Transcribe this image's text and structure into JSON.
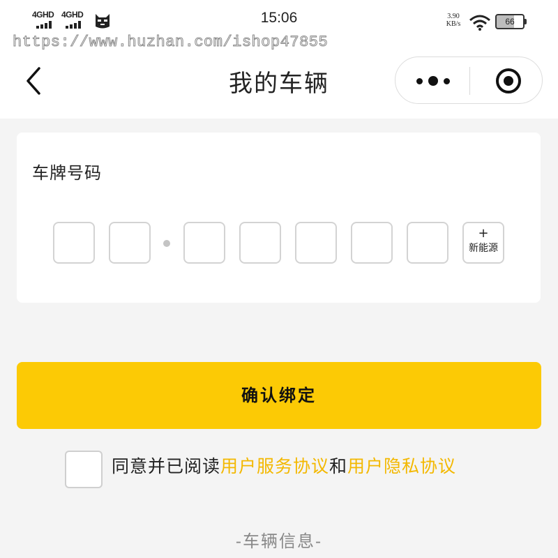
{
  "status_bar": {
    "signal1": "4GHD",
    "signal2": "4GHD",
    "time": "15:06",
    "speed_value": "3.90",
    "speed_unit": "KB/s",
    "battery": "66",
    "battery_level": 0.66
  },
  "watermark": "https://www.huzhan.com/ishop47855",
  "nav": {
    "back_icon": "chevron-left-icon",
    "title": "我的车辆",
    "more_icon": "more-dots-icon",
    "close_icon": "target-close-icon"
  },
  "plate": {
    "label": "车牌号码",
    "boxes": [
      "",
      "",
      "",
      "",
      "",
      "",
      ""
    ],
    "new_energy_plus": "+",
    "new_energy_label": "新能源"
  },
  "confirm_label": "确认绑定",
  "agreement": {
    "prefix": "同意并已阅读",
    "link1": "用户服务协议",
    "conj": "和",
    "link2": "用户隐私协议"
  },
  "section_title": "-车辆信息-",
  "colors": {
    "accent": "#fcca05",
    "link": "#f3b800",
    "background": "#f4f4f4"
  }
}
